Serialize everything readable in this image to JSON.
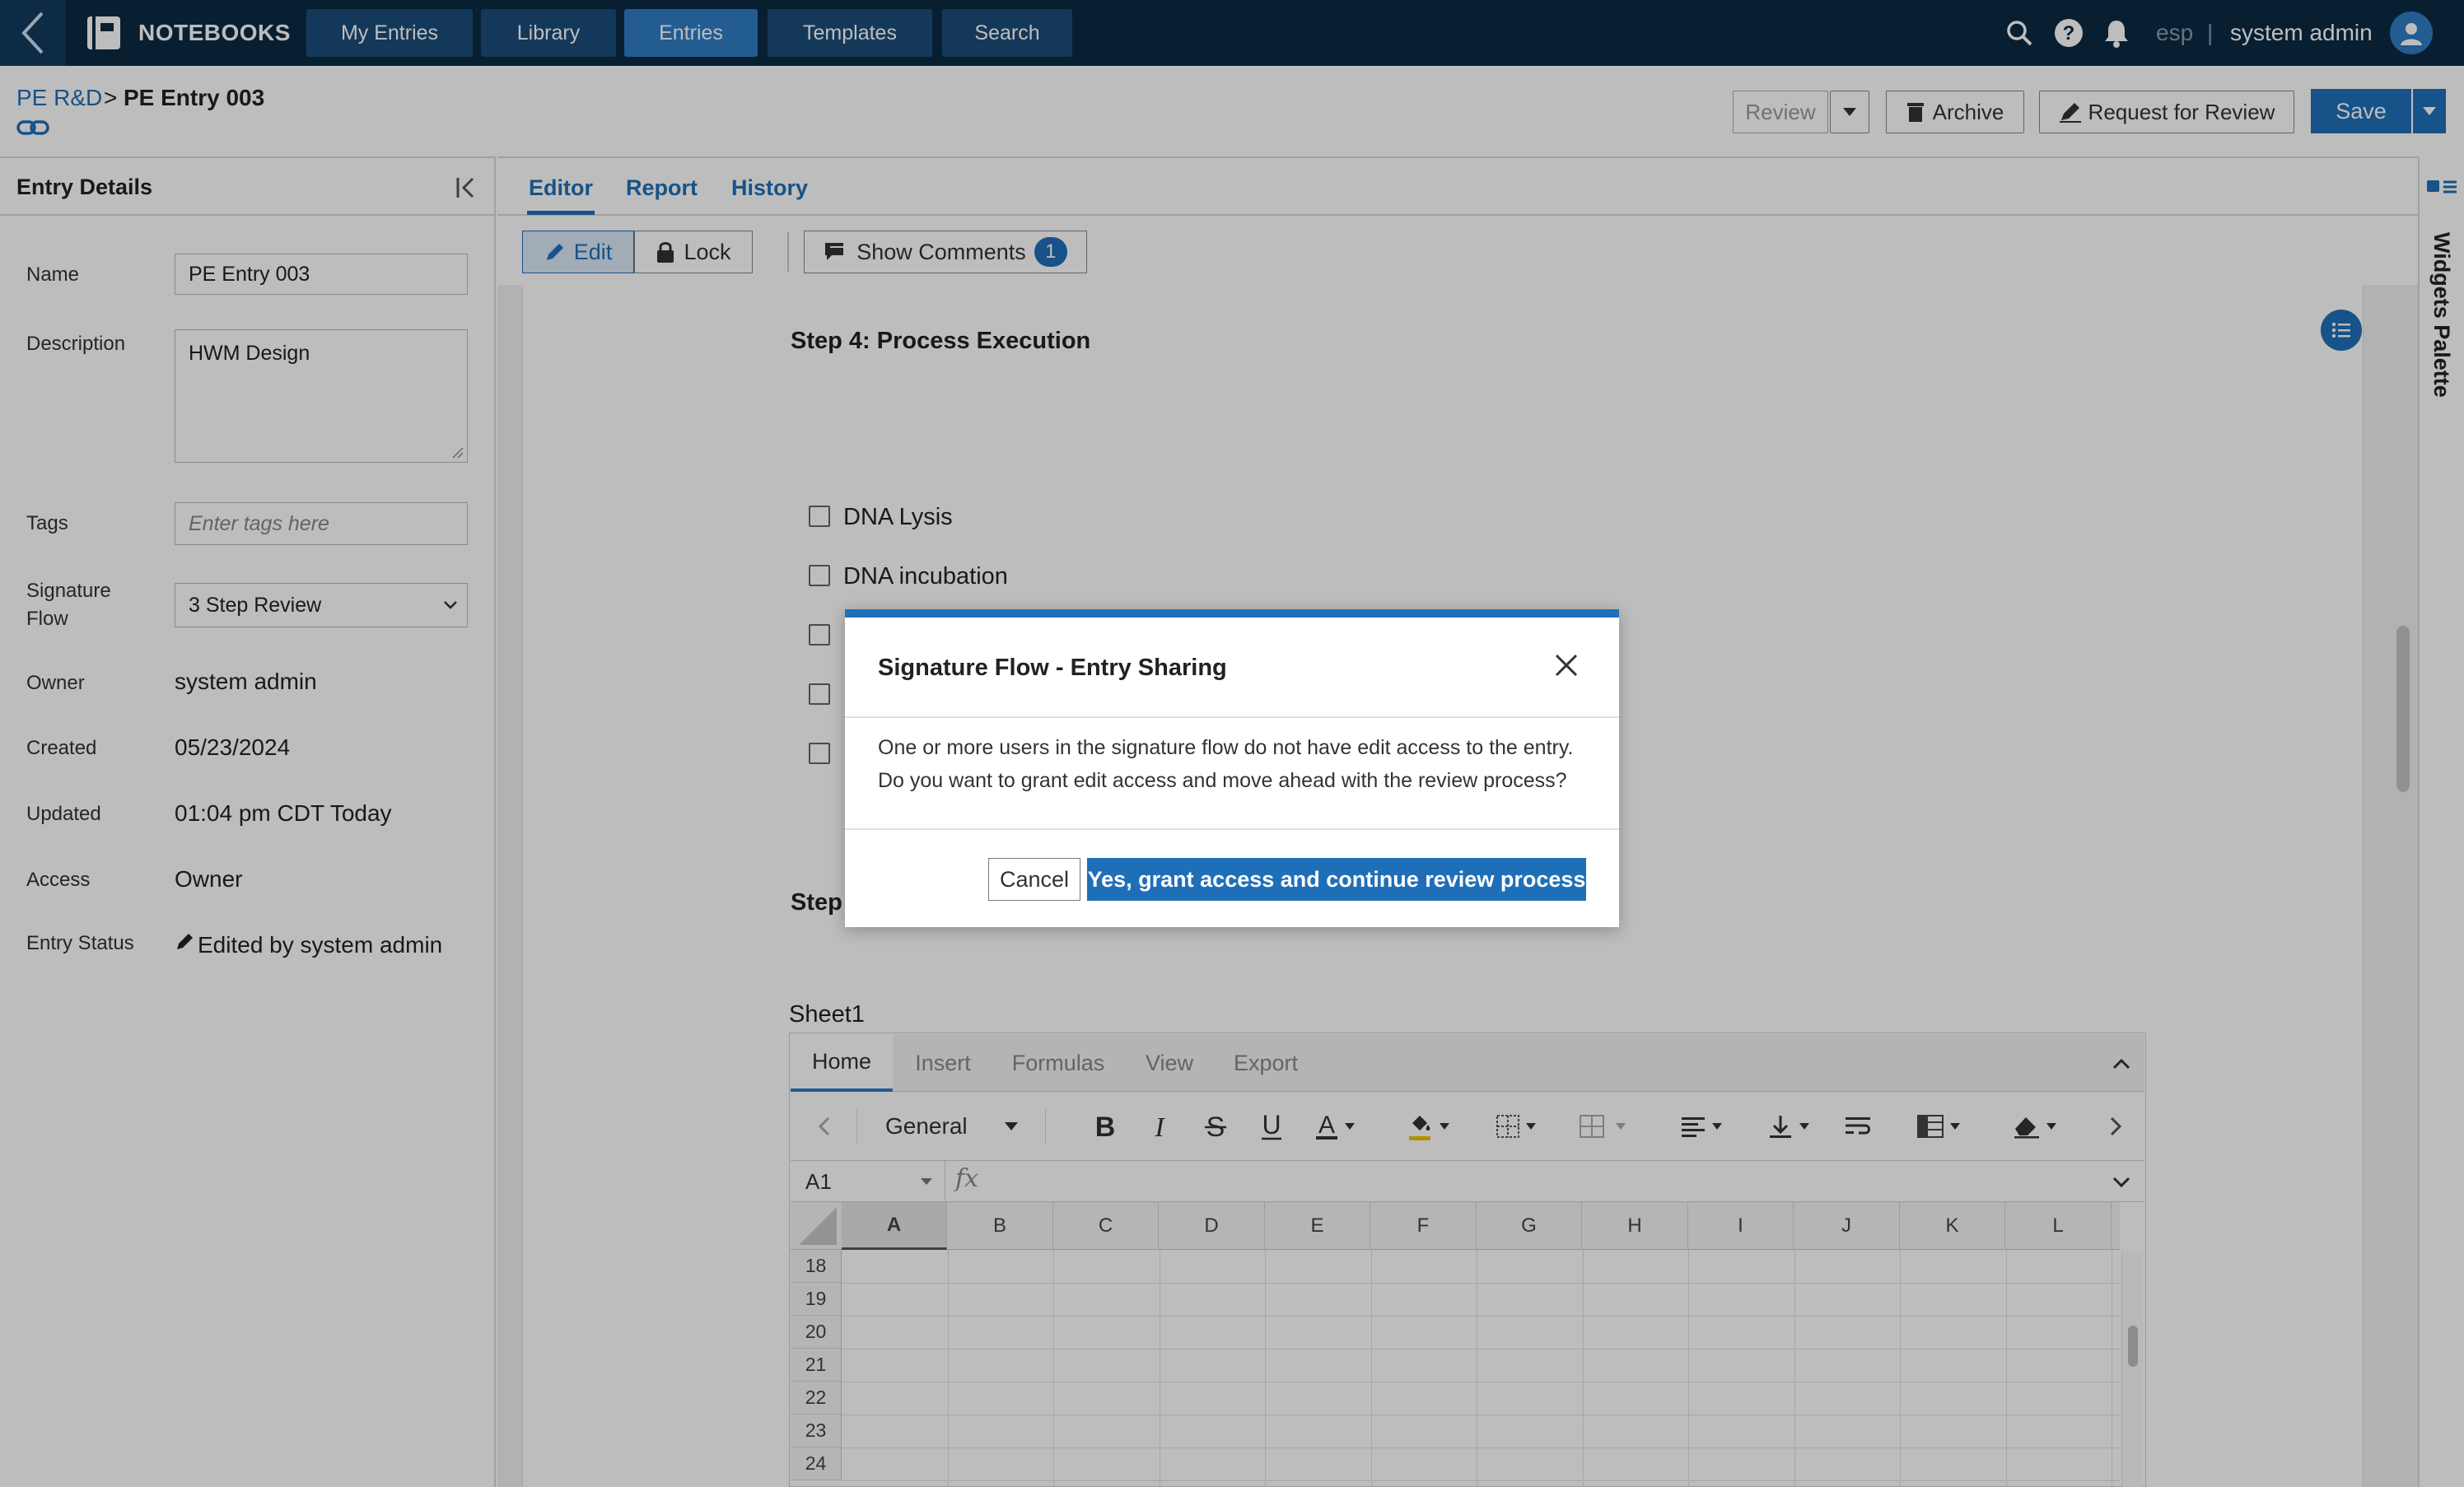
{
  "topbar": {
    "app_name": "NOTEBOOKS",
    "nav": [
      "My Entries",
      "Library",
      "Entries",
      "Templates",
      "Search"
    ],
    "active_nav": "Entries",
    "language": "esp",
    "separator": "|",
    "user": "system admin"
  },
  "breadcrumb": {
    "parent": "PE R&D",
    "separator": ">",
    "current": "PE Entry 003"
  },
  "header_actions": {
    "review": "Review",
    "archive": "Archive",
    "request_review": "Request for Review",
    "save": "Save"
  },
  "entry_details": {
    "title": "Entry Details",
    "fields": {
      "name_label": "Name",
      "name_value": "PE Entry 003",
      "description_label": "Description",
      "description_value": "HWM Design",
      "tags_label": "Tags",
      "tags_placeholder": "Enter tags here",
      "signature_flow_label_1": "Signature",
      "signature_flow_label_2": "Flow",
      "signature_flow_value": "3 Step Review",
      "owner_label": "Owner",
      "owner_value": "system admin",
      "created_label": "Created",
      "created_value": "05/23/2024",
      "updated_label": "Updated",
      "updated_value": "01:04 pm CDT Today",
      "access_label": "Access",
      "access_value": "Owner",
      "entry_status_label": "Entry Status",
      "entry_status_value": "Edited by system admin"
    }
  },
  "tabs": [
    "Editor",
    "Report",
    "History"
  ],
  "active_tab": "Editor",
  "editor_toolbar": {
    "edit": "Edit",
    "lock": "Lock",
    "show_comments": "Show Comments",
    "comment_count": "1"
  },
  "widgets_palette": "Widgets Palette",
  "document": {
    "step4_title": "Step 4: Process Execution",
    "checklist": [
      "DNA Lysis",
      "DNA incubation"
    ],
    "step5_prefix": "Step"
  },
  "spreadsheet": {
    "sheet_name": "Sheet1",
    "ribbon_tabs": [
      "Home",
      "Insert",
      "Formulas",
      "View",
      "Export"
    ],
    "active_ribbon_tab": "Home",
    "number_format": "General",
    "cell_ref": "A1",
    "fx": "fx",
    "columns": [
      "A",
      "B",
      "C",
      "D",
      "E",
      "F",
      "G",
      "H",
      "I",
      "J",
      "K",
      "L"
    ],
    "rows": [
      "18",
      "19",
      "20",
      "21",
      "22",
      "23",
      "24"
    ]
  },
  "modal": {
    "title": "Signature Flow - Entry Sharing",
    "body_line1": "One or more users in the signature flow do not have edit access to the entry.",
    "body_line2": "Do you want to grant edit access and move ahead with the review process?",
    "cancel": "Cancel",
    "confirm": "Yes, grant access and continue review process"
  },
  "colors": {
    "topbar": "#0b2a44",
    "primary": "#1f6fb8",
    "nav_active": "#2f7cc4"
  }
}
